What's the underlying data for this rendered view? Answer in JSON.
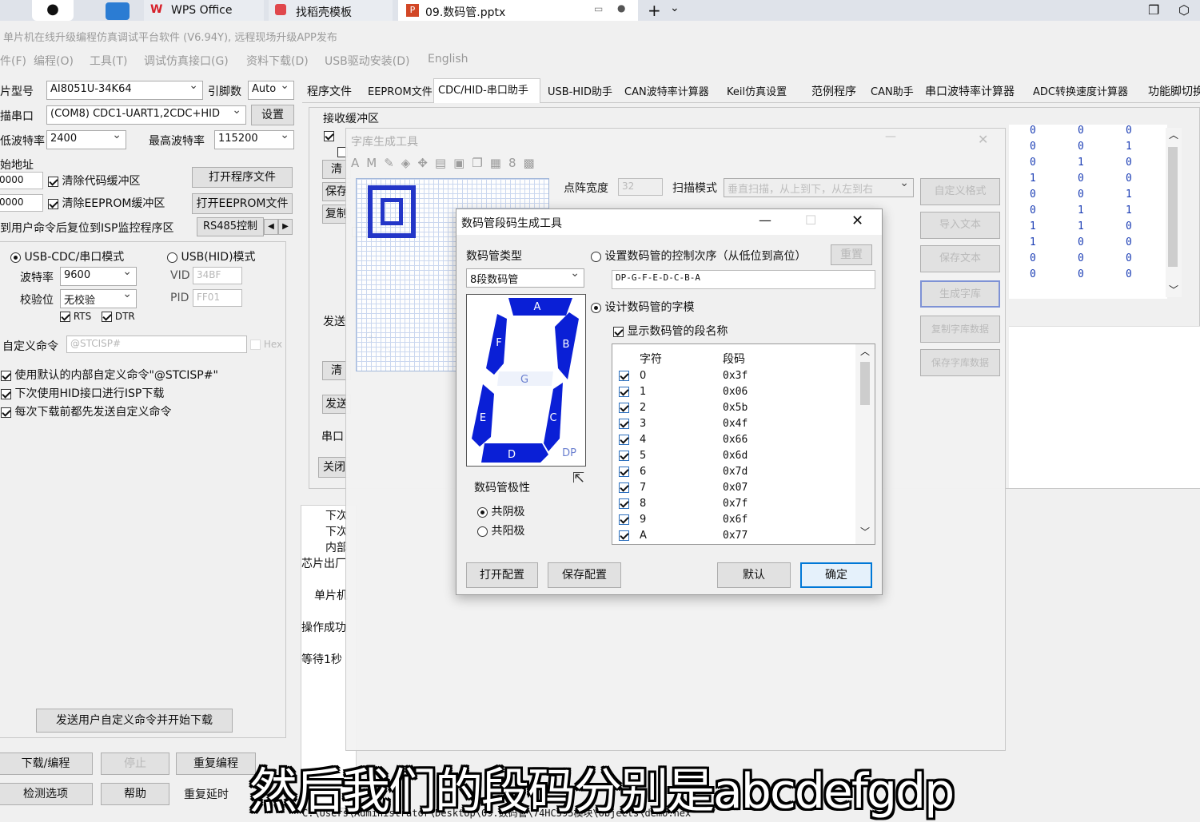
{
  "taskbar": {
    "tab1": "WPS Office",
    "tab2": "找稻壳模板",
    "tab3": "09.数码管.pptx",
    "plus": "+"
  },
  "app": {
    "title": "单片机在线升级编程仿真调试平台软件 (V6.94Y), 远程现场升级APP发布",
    "menu": [
      "件(F)",
      "编程(O)",
      "工具(T)",
      "调试仿真接口(G)",
      "资料下载(D)",
      "USB驱动安装(D)",
      "English"
    ]
  },
  "left": {
    "chip_label": "芯片型号",
    "chip_value": "AI8051U-34K64",
    "pins_label": "引脚数",
    "pins_value": "Auto",
    "port_label": "扫描串口",
    "port_value": "(COM8) CDC1-UART1,2CDC+HID",
    "settings_btn": "设置",
    "low_baud_label": "最低波特率",
    "low_baud_value": "2400",
    "high_baud_label": "最高波特率",
    "high_baud_value": "115200",
    "start_addr_label": "起始地址",
    "addr1": "0000",
    "addr2": "0000",
    "clear_code": "清除代码缓冲区",
    "clear_eeprom": "清除EEPROM缓冲区",
    "open_prog": "打开程序文件",
    "open_eeprom": "打开EEPROM文件",
    "isp_reset": "收到用户命令后复位到ISP监控程序区",
    "rs485": "RS485控制",
    "mode_cdc": "USB-CDC/串口模式",
    "mode_hid": "USB(HID)模式",
    "baud_label": "波特率",
    "baud_value": "9600",
    "parity_label": "校验位",
    "parity_value": "无校验",
    "vid_label": "VID",
    "vid_value": "34BF",
    "pid_label": "PID",
    "pid_value": "FF01",
    "rts": "RTS",
    "dtr": "DTR",
    "custom_cmd_label": "自定义命令",
    "custom_cmd_value": "@STCISP#",
    "hex": "Hex",
    "opt1": "使用默认的内部自定义命令\"@STCISP#\"",
    "opt2": "下次使用HID接口进行ISP下载",
    "opt3": "每次下载前都先发送自定义命令",
    "send_download": "发送用户自定义命令并开始下载",
    "download_btn": "下载/编程",
    "stop_btn": "停止",
    "reprog_btn": "重复编程",
    "detect_btn": "检测选项",
    "help_btn": "帮助",
    "repeat_delay": "重复延时"
  },
  "tabs": [
    "程序文件",
    "EEPROM文件",
    "CDC/HID-串口助手",
    "USB-HID助手",
    "CAN波特率计算器",
    "Keil仿真设置",
    "范例程序",
    "CAN助手",
    "串口波特率计算器",
    "ADC转换速度计算器",
    "功能脚切换"
  ],
  "serial": {
    "recv_label": "接收缓冲区",
    "clear": "清",
    "save": "保存",
    "copy": "复制",
    "send_label": "发送",
    "send_btn": "发送",
    "port_label": "串口",
    "close_btn": "关闭"
  },
  "log": [
    "下次",
    "下次",
    "内部",
    "芯片出厂",
    "单片机",
    "操作成功",
    "等待1秒"
  ],
  "font_tool": {
    "title": "字库生成工具",
    "dot_width_label": "点阵宽度",
    "dot_width_value": "32",
    "scan_label": "扫描模式",
    "scan_value": "垂直扫描，从上到下，从左到右",
    "side_buttons": [
      "自定义格式",
      "导入文本",
      "保存文本",
      "生成字库",
      "复制字库数据",
      "保存字库数据"
    ]
  },
  "matrix_rows": [
    [
      "0",
      "0",
      "0"
    ],
    [
      "0",
      "0",
      "1"
    ],
    [
      "0",
      "1",
      "0"
    ],
    [
      "1",
      "0",
      "0"
    ],
    [
      "0",
      "0",
      "1"
    ],
    [
      "0",
      "1",
      "1"
    ],
    [
      "1",
      "1",
      "0"
    ],
    [
      "1",
      "0",
      "0"
    ],
    [
      "0",
      "0",
      "0"
    ],
    [
      "0",
      "0",
      "0"
    ]
  ],
  "dialog": {
    "title": "数码管段码生成工具",
    "type_label": "数码管类型",
    "type_value": "8段数码管",
    "ctrl_order_label": "设置数码管的控制次序（从低位到高位）",
    "reset_btn": "重置",
    "order_value": "DP-G-F-E-D-C-B-A",
    "design_label": "设计数码管的字模",
    "show_names_label": "显示数码管的段名称",
    "col_char": "字符",
    "col_code": "段码",
    "rows": [
      {
        "char": "0",
        "code": "0x3f"
      },
      {
        "char": "1",
        "code": "0x06"
      },
      {
        "char": "2",
        "code": "0x5b"
      },
      {
        "char": "3",
        "code": "0x4f"
      },
      {
        "char": "4",
        "code": "0x66"
      },
      {
        "char": "5",
        "code": "0x6d"
      },
      {
        "char": "6",
        "code": "0x7d"
      },
      {
        "char": "7",
        "code": "0x07"
      },
      {
        "char": "8",
        "code": "0x7f"
      },
      {
        "char": "9",
        "code": "0x6f"
      },
      {
        "char": "A",
        "code": "0x77"
      }
    ],
    "segments": {
      "a": "A",
      "b": "B",
      "c": "C",
      "d": "D",
      "e": "E",
      "f": "F",
      "g": "G",
      "dp": "DP"
    },
    "polarity_label": "数码管极性",
    "cathode": "共阴极",
    "anode": "共阳极",
    "open_cfg": "打开配置",
    "save_cfg": "保存配置",
    "default_btn": "默认",
    "ok_btn": "确定",
    "seg_color": "#0a1fd6"
  },
  "status_path": "C:\\Users\\Administrator\\Desktop\\09.数码管\\74HC595模块\\Objects\\demo.hex",
  "subtitle": "然后我们的段码分别是abcdefgdp"
}
